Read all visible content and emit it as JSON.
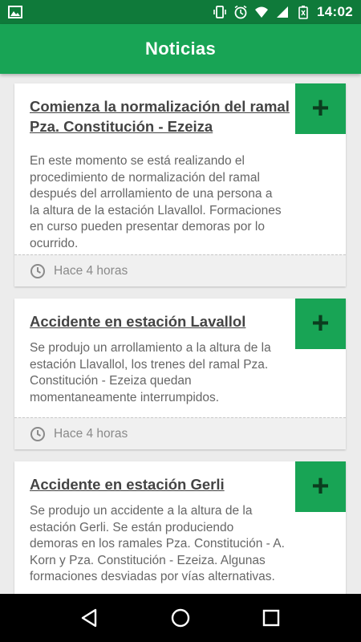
{
  "status_bar": {
    "time": "14:02",
    "icons": [
      "image-icon",
      "vibrate-icon",
      "alarm-icon",
      "wifi-icon",
      "signal-icon",
      "battery-icon"
    ]
  },
  "app_bar": {
    "title": "Noticias"
  },
  "colors": {
    "primary": "#18a455",
    "status_bar": "#0f7a3a",
    "plus_icon": "#0b3d1f"
  },
  "news": [
    {
      "title": "Comienza la normalización del ramal Pza. Constitución - Ezeiza",
      "body": "En este momento se está realizando el procedimiento de normalización del ramal después del arrollamiento de una persona a la altura de la estación Llavallol. Formaciones en curso pueden presentar demoras por lo ocurrido.",
      "time": "Hace 4 horas",
      "action": "+"
    },
    {
      "title": "Accidente en estación Lavallol",
      "body": "Se produjo un arrollamiento a la altura de la estación Llavallol, los trenes del ramal Pza. Constitución - Ezeiza quedan momentaneamente interrumpidos.",
      "time": "Hace 4 horas",
      "action": "+"
    },
    {
      "title": "Accidente en estación Gerli",
      "body": "Se produjo un accidente a la altura de la estación Gerli. Se están produciendo demoras en los ramales Pza. Constitución - A. Korn y Pza. Constitución - Ezeiza. Algunas formaciones desviadas por vías alternativas.",
      "time": "",
      "action": "+"
    }
  ],
  "nav_bar": {
    "buttons": [
      "back-icon",
      "home-icon",
      "recents-icon"
    ]
  }
}
